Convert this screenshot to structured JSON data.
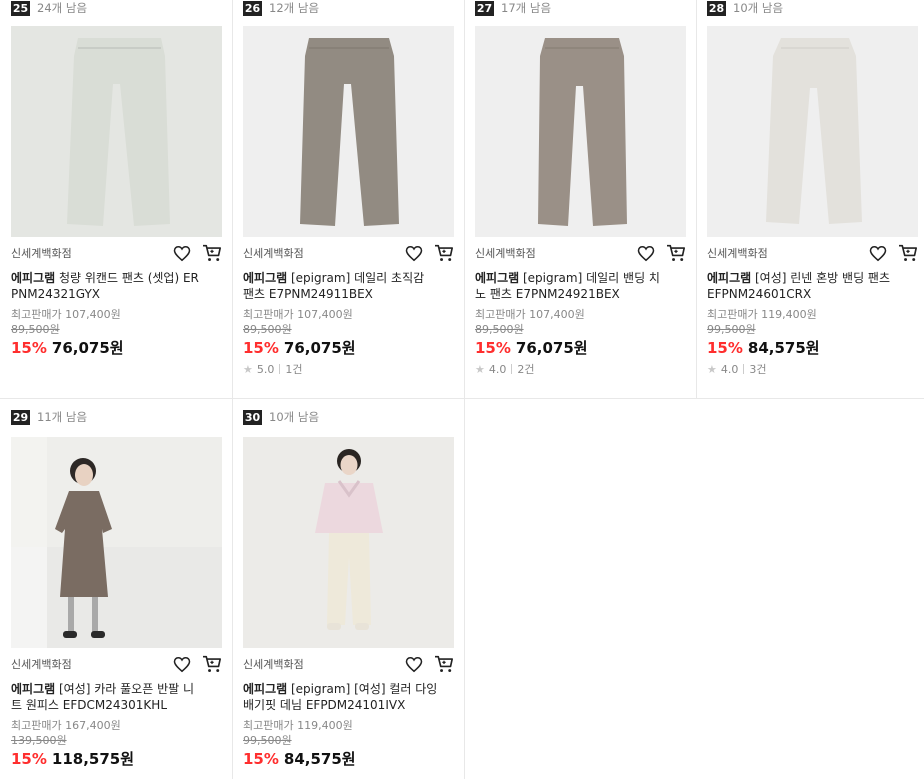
{
  "products": [
    {
      "rank": "25",
      "remain": "24개 남음",
      "store": "신세계백화점",
      "brand": "에피그램",
      "name_line1": " 청량 위캔드 팬츠 (셋업) ER",
      "name_line2": "PNM24321GYX",
      "max_price_label": "최고판매가 107,400원",
      "original_price": "89,500원",
      "discount": "15%",
      "price": "76,075원",
      "rating": "",
      "review_count": "",
      "image_color": "#e4e6e2",
      "item_color": "#d9ddd6"
    },
    {
      "rank": "26",
      "remain": "12개 남음",
      "store": "신세계백화점",
      "brand": "에피그램",
      "name_line1": " [epigram] 데일리 초직감",
      "name_line2": "팬츠 E7PNM24911BEX",
      "max_price_label": "최고판매가 107,400원",
      "original_price": "89,500원",
      "discount": "15%",
      "price": "76,075원",
      "rating": "5.0",
      "review_count": "1건",
      "image_color": "#efefef",
      "item_color": "#928b82"
    },
    {
      "rank": "27",
      "remain": "17개 남음",
      "store": "신세계백화점",
      "brand": "에피그램",
      "name_line1": " [epigram] 데일리 밴딩 치",
      "name_line2": "노 팬츠 E7PNM24921BEX",
      "max_price_label": "최고판매가 107,400원",
      "original_price": "89,500원",
      "discount": "15%",
      "price": "76,075원",
      "rating": "4.0",
      "review_count": "2건",
      "image_color": "#efefef",
      "item_color": "#9a9087"
    },
    {
      "rank": "28",
      "remain": "10개 남음",
      "store": "신세계백화점",
      "brand": "에피그램",
      "name_line1": " [여성] 린넨 혼방 밴딩 팬츠",
      "name_line2": "EFPNM24601CRX",
      "max_price_label": "최고판매가 119,400원",
      "original_price": "99,500원",
      "discount": "15%",
      "price": "84,575원",
      "rating": "4.0",
      "review_count": "3건",
      "image_color": "#efefef",
      "item_color": "#e3e1dc"
    },
    {
      "rank": "29",
      "remain": "11개 남음",
      "store": "신세계백화점",
      "brand": "에피그램",
      "name_line1": " [여성] 카라 풀오픈 반팔 니",
      "name_line2": "트 원피스 EFDCM24301KHL",
      "max_price_label": "최고판매가 167,400원",
      "original_price": "139,500원",
      "discount": "15%",
      "price": "118,575원",
      "rating": "",
      "review_count": "",
      "image_color": "#e9e9e7",
      "item_color": "#7a6c62"
    },
    {
      "rank": "30",
      "remain": "10개 남음",
      "store": "신세계백화점",
      "brand": "에피그램",
      "name_line1": " [epigram] [여성] 컬러 다잉",
      "name_line2": "배기핏 데님 EFPDM24101IVX",
      "max_price_label": "최고판매가 119,400원",
      "original_price": "99,500원",
      "discount": "15%",
      "price": "84,575원",
      "rating": "",
      "review_count": "",
      "image_color": "#ecebe8",
      "item_color": "#eee9da"
    }
  ],
  "icons": {
    "wish": "heart-icon",
    "cart": "cart-icon",
    "star": "star-icon"
  }
}
